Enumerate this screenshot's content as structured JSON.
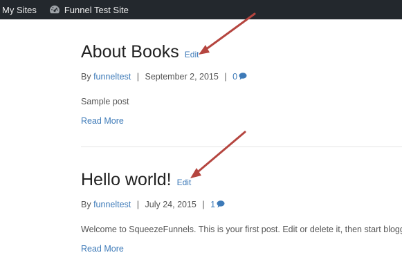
{
  "adminbar": {
    "my_sites_label": "My Sites",
    "site_name": "Funnel Test Site"
  },
  "posts": [
    {
      "title": "About Books",
      "edit_label": "Edit",
      "by_label": "By",
      "author": "funneltest",
      "date": "September 2, 2015",
      "comment_count": "0",
      "excerpt": "Sample post",
      "read_more_label": "Read More"
    },
    {
      "title": "Hello world!",
      "edit_label": "Edit",
      "by_label": "By",
      "author": "funneltest",
      "date": "July 24, 2015",
      "comment_count": "1",
      "excerpt": "Welcome to SqueezeFunnels. This is your first post. Edit or delete it, then start blogging!",
      "read_more_label": "Read More"
    }
  ],
  "colors": {
    "adminbar_bg": "#23282d",
    "link": "#3d7ab8",
    "annotation_arrow": "#c0504d"
  }
}
